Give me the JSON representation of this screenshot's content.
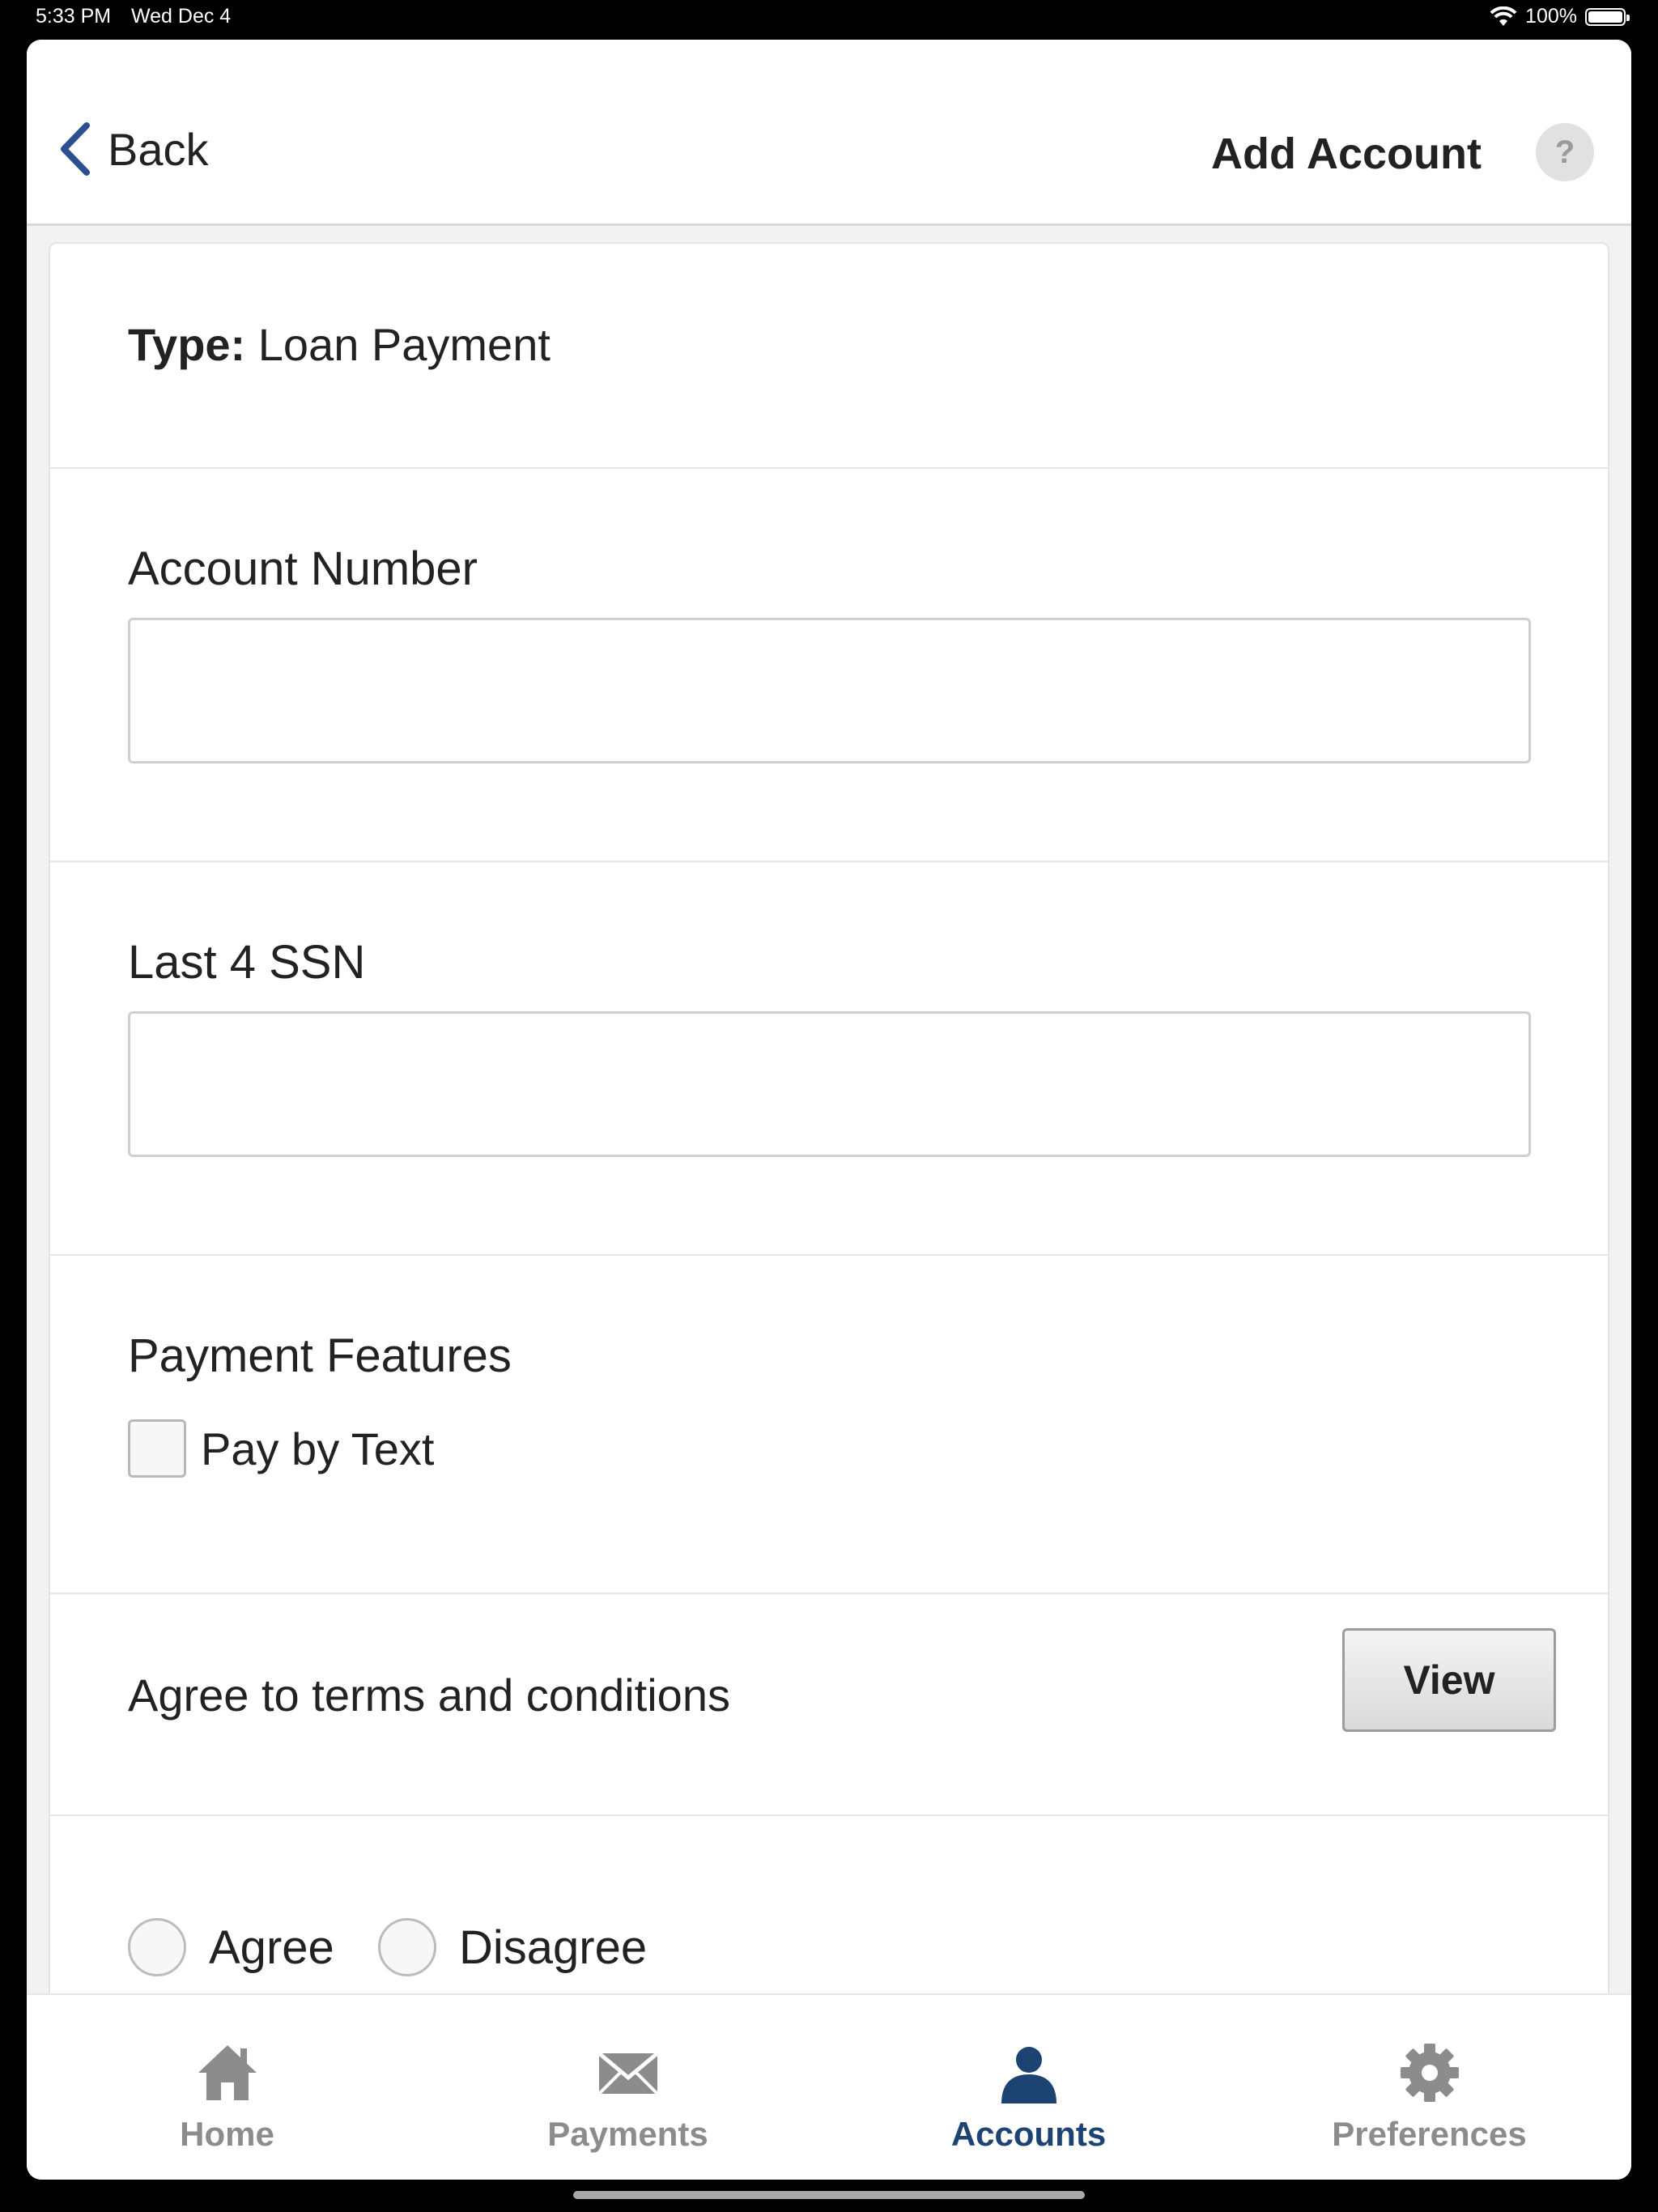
{
  "status_bar": {
    "time": "5:33 PM",
    "date": "Wed Dec 4",
    "battery": "100%"
  },
  "header": {
    "back_label": "Back",
    "title": "Add Account",
    "help_label": "?"
  },
  "form": {
    "type_key": "Type:",
    "type_value": "Loan Payment",
    "account_number_label": "Account Number",
    "account_number_value": "",
    "ssn_label": "Last 4 SSN",
    "ssn_value": "",
    "features_title": "Payment Features",
    "pay_by_text_label": "Pay by Text",
    "terms_label": "Agree to terms and conditions",
    "view_label": "View",
    "agree_label": "Agree",
    "disagree_label": "Disagree"
  },
  "tabs": [
    {
      "label": "Home",
      "icon": "home-icon",
      "active": false
    },
    {
      "label": "Payments",
      "icon": "envelope-icon",
      "active": false
    },
    {
      "label": "Accounts",
      "icon": "person-icon",
      "active": true
    },
    {
      "label": "Preferences",
      "icon": "gear-icon",
      "active": false
    }
  ],
  "colors": {
    "accent": "#1d4373",
    "back_chevron": "#2c4f8f",
    "inactive_tab": "#8c8c8c"
  }
}
